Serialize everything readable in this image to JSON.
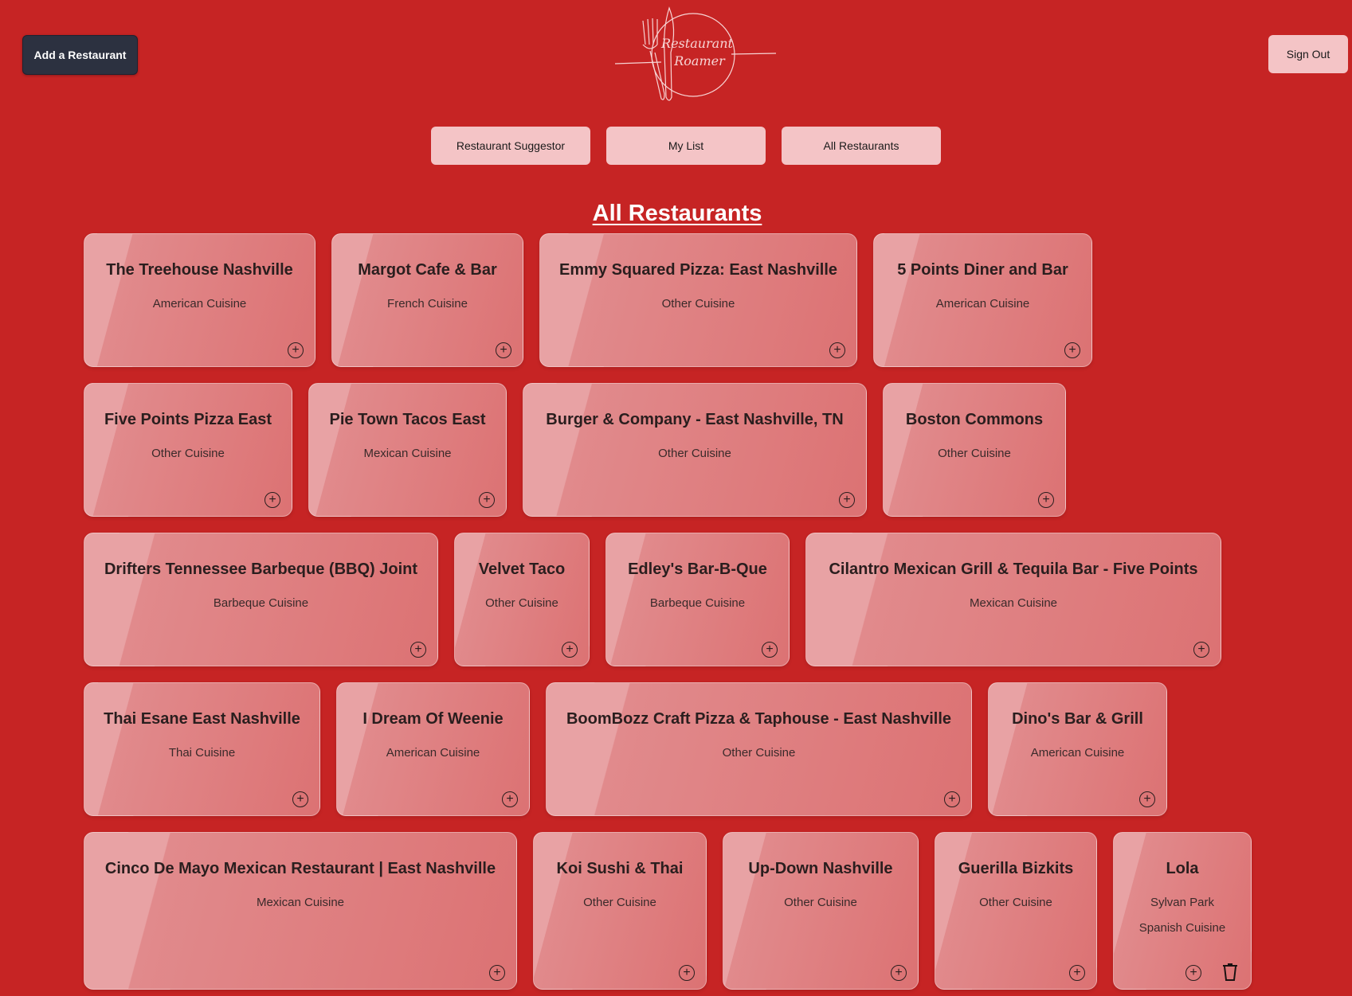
{
  "header": {
    "add_button": "Add a Restaurant",
    "sign_out_button": "Sign Out",
    "logo_text_line1": "Restaurant",
    "logo_text_line2": "Roamer"
  },
  "nav": {
    "items": [
      {
        "label": "Restaurant Suggestor"
      },
      {
        "label": "My List"
      },
      {
        "label": "All Restaurants"
      }
    ]
  },
  "page_title": "All Restaurants",
  "restaurants": [
    {
      "name": "The Treehouse Nashville",
      "cuisine": "American Cuisine"
    },
    {
      "name": "Margot Cafe & Bar",
      "cuisine": "French Cuisine"
    },
    {
      "name": "Emmy Squared Pizza: East Nashville",
      "cuisine": "Other Cuisine"
    },
    {
      "name": "5 Points Diner and Bar",
      "cuisine": "American Cuisine"
    },
    {
      "name": "Five Points Pizza East",
      "cuisine": "Other Cuisine"
    },
    {
      "name": "Pie Town Tacos East",
      "cuisine": "Mexican Cuisine"
    },
    {
      "name": "Burger & Company - East Nashville, TN",
      "cuisine": "Other Cuisine"
    },
    {
      "name": "Boston Commons",
      "cuisine": "Other Cuisine"
    },
    {
      "name": "Drifters Tennessee Barbeque (BBQ) Joint",
      "cuisine": "Barbeque Cuisine"
    },
    {
      "name": "Velvet Taco",
      "cuisine": "Other Cuisine"
    },
    {
      "name": "Edley's Bar-B-Que",
      "cuisine": "Barbeque Cuisine"
    },
    {
      "name": "Cilantro Mexican Grill & Tequila Bar - Five Points",
      "cuisine": "Mexican Cuisine"
    },
    {
      "name": "Thai Esane East Nashville",
      "cuisine": "Thai Cuisine"
    },
    {
      "name": "I Dream Of Weenie",
      "cuisine": "American Cuisine"
    },
    {
      "name": "BoomBozz Craft Pizza & Taphouse - East Nashville",
      "cuisine": "Other Cuisine"
    },
    {
      "name": "Dino's Bar & Grill",
      "cuisine": "American Cuisine"
    },
    {
      "name": "Cinco De Mayo Mexican Restaurant | East Nashville",
      "cuisine": "Mexican Cuisine"
    },
    {
      "name": "Koi Sushi & Thai",
      "cuisine": "Other Cuisine"
    },
    {
      "name": "Up-Down Nashville",
      "cuisine": "Other Cuisine"
    },
    {
      "name": "Guerilla Bizkits",
      "cuisine": "Other Cuisine"
    },
    {
      "name": "Lola",
      "location": "Sylvan Park",
      "cuisine": "Spanish Cuisine"
    }
  ],
  "add_icon": "plus-circle-icon",
  "delete_icon": "trash-icon",
  "colors": {
    "background": "#c62424",
    "card": "#e18a8c",
    "nav_button": "#f4c4c6",
    "add_button": "#2c3140"
  }
}
